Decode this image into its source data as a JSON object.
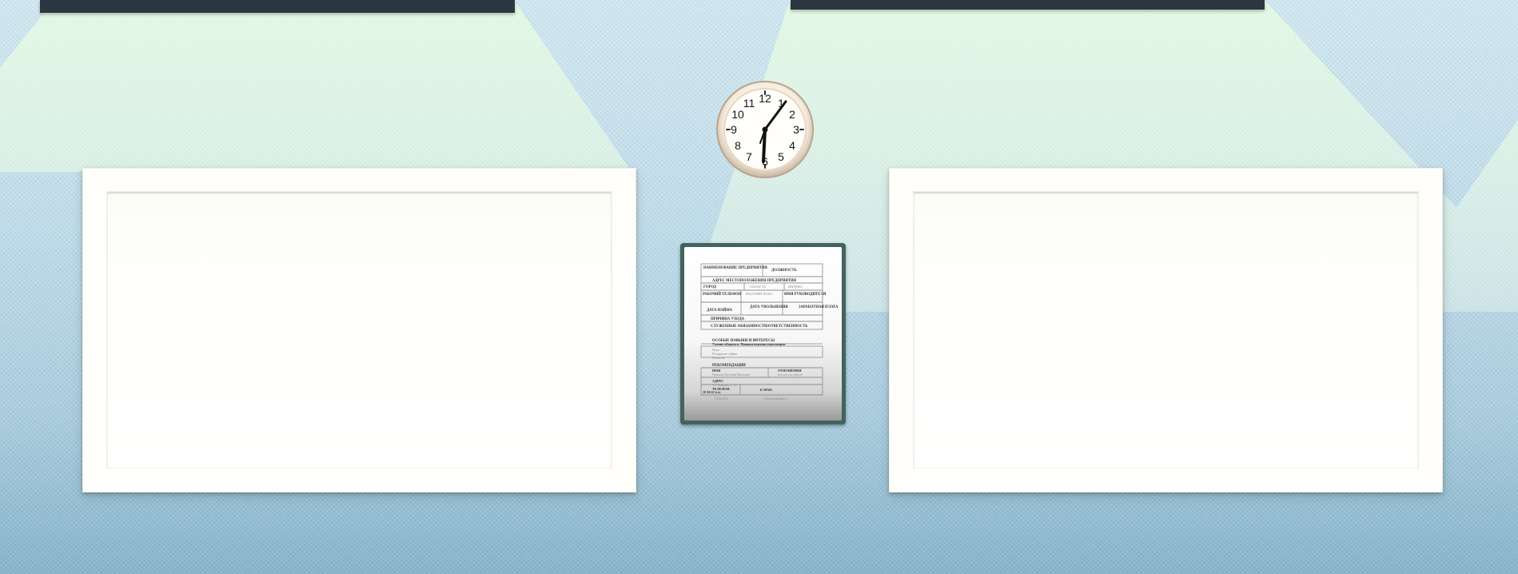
{
  "scene": {
    "colors": {
      "wall_top": "#d3ebf4",
      "wall_bottom": "#87b6cd",
      "lamp": "#2b3640",
      "light_beam": "#eaffe0",
      "board": "#fffefa",
      "form_frame": "#43635d"
    }
  },
  "clock": {
    "numbers": [
      "12",
      "1",
      "2",
      "3",
      "4",
      "5",
      "6",
      "7",
      "8",
      "9",
      "10",
      "11"
    ],
    "time_shown": "6:07",
    "icon": "wall-clock-icon"
  },
  "form": {
    "rows": {
      "company_name": "НАИМЕНОВАНИЕ ПРЕДПРИЯТИЯ",
      "position": "ДОЛЖНОСТЬ",
      "address": "АДРЕС МЕСТОПОЛОЖЕНИЯ ПРЕДПРИЯТИЯ",
      "city": "ГОРОД",
      "region": "ОБЛАСТЬ",
      "postal_code": "ИНДЕКС",
      "work_phone": "РАБОЧИЙ ТЕЛЕФОН",
      "work_fax": "РАБОЧИЙ ФАКС",
      "manager_name": "ИМЯ РУКОВОДИТЕЛЯ",
      "hire_date": "ДАТА НАЙМА",
      "dismissal_date": "ДАТА УВОЛЬНЕНИЯ",
      "final_pay": "ЗАРАБОТНАЯ ПЛАТА",
      "reason": "ПРИЧИНА УХОДА",
      "duties": "СЛУЖЕБНЫЕ ОБЯЗАННОСТИ/ОТВЕТСТВЕННОСТЬ",
      "special_interests": "ОСОБЫЕ НАВЫКИ И ИНТЕРЕСЫ",
      "skills_line": "Умение общаться. Навыки ведения переговоров",
      "extra_1": "Вера",
      "extra_2": "Раскрытие тайны",
      "extra_3": "Гипнозы",
      "references": "РЕКОМЕНДАЦИИ",
      "ref_name": "ИМЯ",
      "ref_relationship": "ОТНОШЕНИЯ",
      "ref_person": "Пенкина Евгения Павловна",
      "ref_company": "Коллега по работе",
      "ref_address": "АДРЕС",
      "ref_address_value": "Ул. Гвардии, д. 14",
      "ref_phone": "ТЕЛЕФОН",
      "ref_phone_value": "18 30 62 (ст)",
      "ref_email": "E-MAIL",
      "ref_bottom_left": "18.06.2015",
      "ref_bottom_right": "reference@mail.ru"
    }
  }
}
